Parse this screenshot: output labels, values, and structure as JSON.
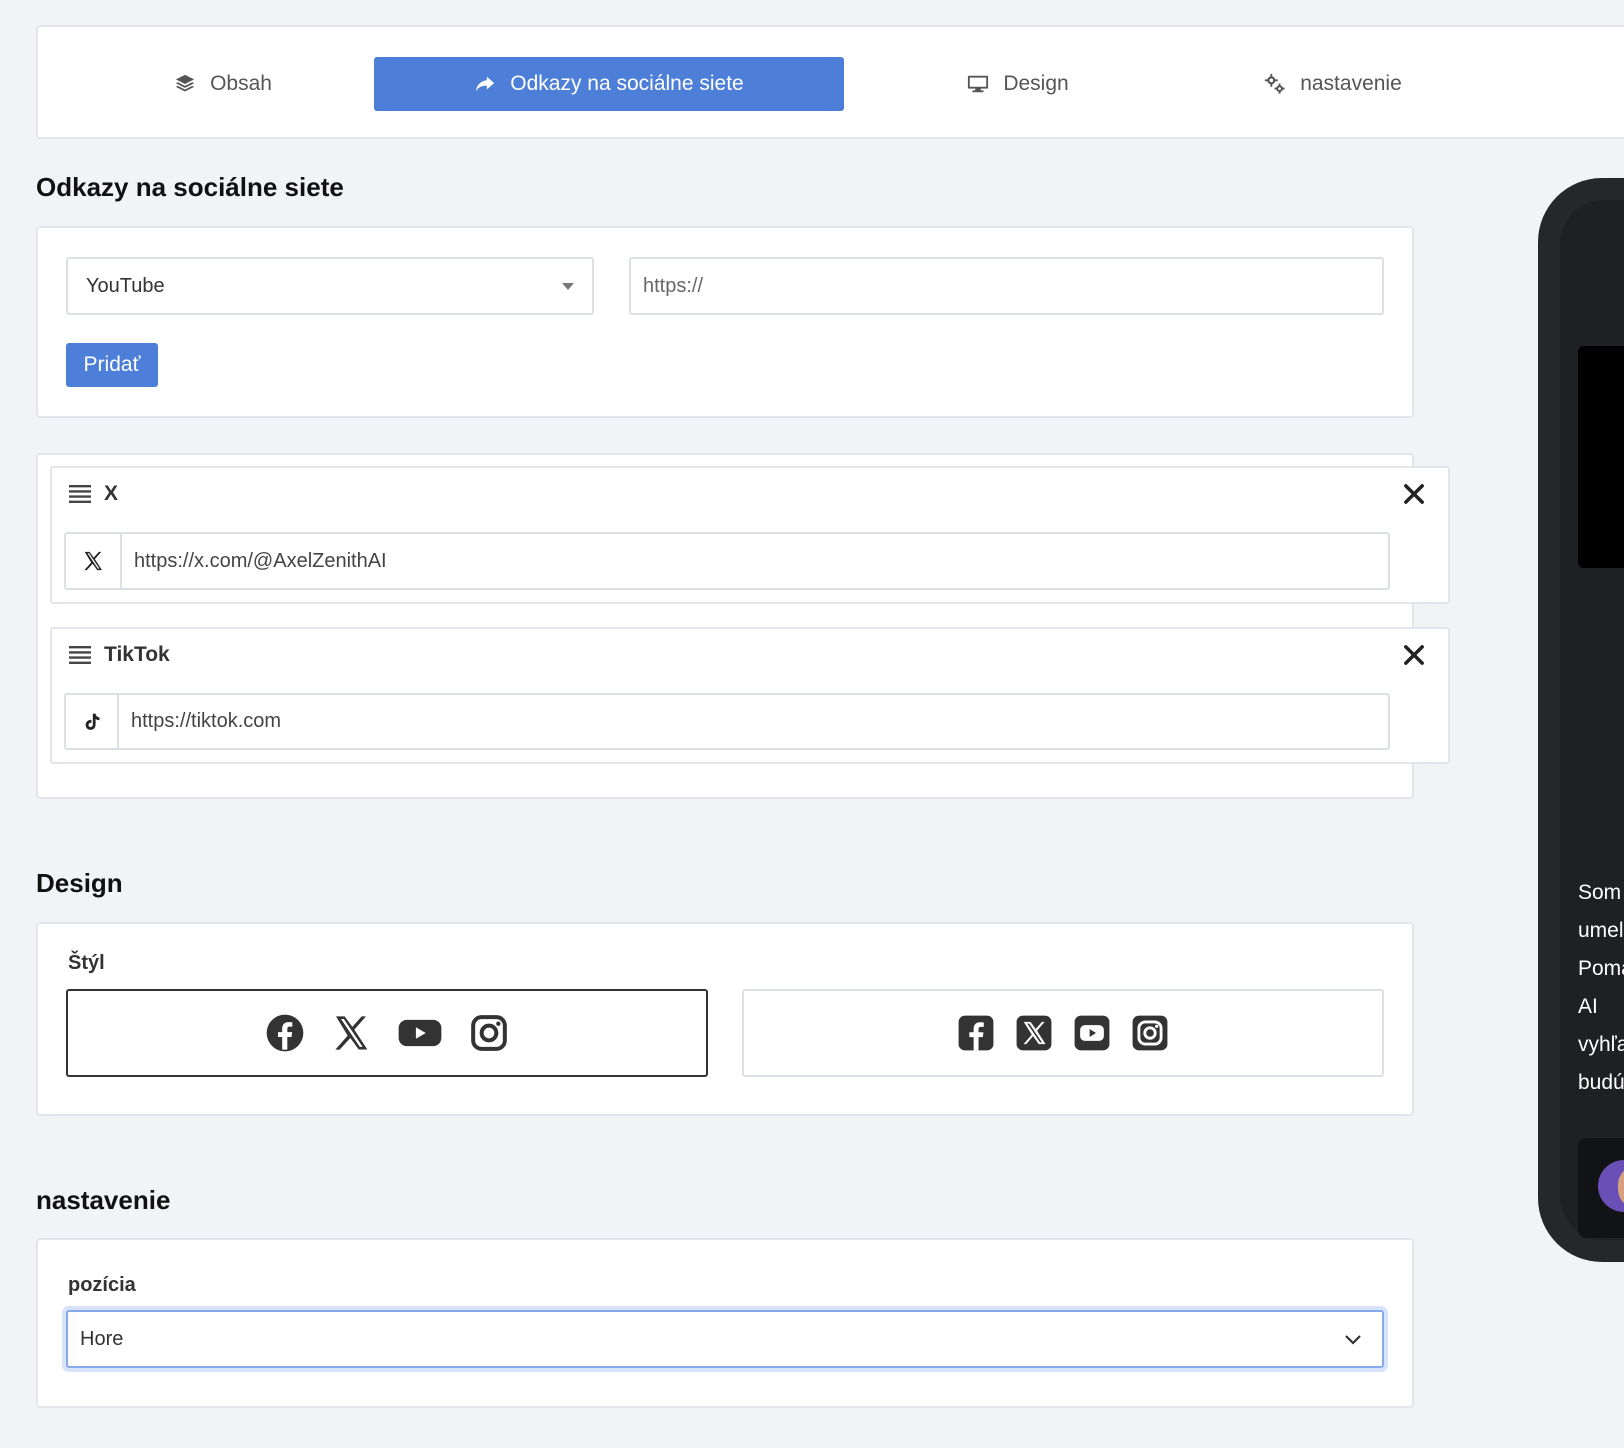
{
  "tabs": [
    {
      "label": "Obsah",
      "icon": "layers-icon"
    },
    {
      "label": "Odkazy na sociálne siete",
      "icon": "share-icon",
      "active": true
    },
    {
      "label": "Design",
      "icon": "monitor-icon"
    },
    {
      "label": "nastavenie",
      "icon": "gears-icon"
    }
  ],
  "social": {
    "heading": "Odkazy na sociálne siete",
    "platform_select": "YouTube",
    "url_placeholder": "https://",
    "add_label": "Pridať",
    "items": [
      {
        "name": "X",
        "icon": "x-icon",
        "url": "https://x.com/@AxelZenithAI"
      },
      {
        "name": "TikTok",
        "icon": "tiktok-icon",
        "url": "https://tiktok.com"
      }
    ]
  },
  "design": {
    "heading": "Design",
    "style_label": "Štýl",
    "styles": [
      {
        "name": "plain-icons",
        "selected": true
      },
      {
        "name": "square-icons",
        "selected": false
      }
    ]
  },
  "settings": {
    "heading": "nastavenie",
    "position_label": "pozícia",
    "position_value": "Hore"
  },
  "preview": {
    "text_lines": [
      "Som",
      "umel",
      "Poma",
      "AI",
      "vyhľa",
      "budú"
    ]
  },
  "colors": {
    "accent": "#4e7fd8",
    "background": "#f2f3f6"
  }
}
